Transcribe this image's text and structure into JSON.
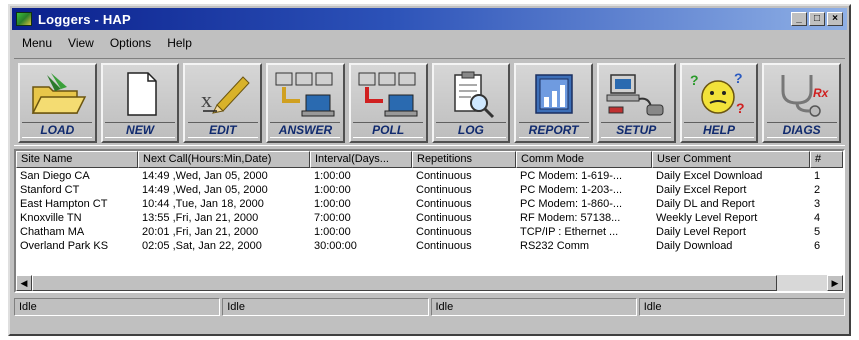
{
  "window": {
    "title": "Loggers - HAP"
  },
  "menu": [
    {
      "label": "Menu"
    },
    {
      "label": "View"
    },
    {
      "label": "Options"
    },
    {
      "label": "Help"
    }
  ],
  "toolbar": {
    "load_label": "LOAD",
    "new_label": "NEW",
    "edit_label": "EDIT",
    "answer_label": "ANSWER",
    "poll_label": "POLL",
    "log_label": "LOG",
    "report_label": "REPORT",
    "setup_label": "SETUP",
    "help_label": "HELP",
    "diags_label": "DIAGS",
    "icons": [
      "folder-open-icon",
      "new-document-icon",
      "pencil-icon",
      "answer-icon",
      "poll-icon",
      "clipboard-magnifier-icon",
      "report-icon",
      "setup-computer-icon",
      "smiley-help-icon",
      "stethoscope-icon"
    ]
  },
  "table": {
    "headers": [
      "Site Name",
      "Next Call(Hours:Min,Date)",
      "Interval(Days...",
      "Repetitions",
      "Comm Mode",
      "User Comment",
      "#"
    ],
    "rows": [
      [
        "San Diego CA",
        "14:49 ,Wed, Jan 05, 2000",
        "1:00:00",
        "Continuous",
        "PC Modem: 1-619-...",
        "Daily Excel Download",
        "1"
      ],
      [
        "Stanford CT",
        "14:49 ,Wed, Jan 05, 2000",
        "1:00:00",
        "Continuous",
        "PC Modem: 1-203-...",
        "Daily Excel Report",
        "2"
      ],
      [
        "East Hampton CT",
        "10:44 ,Tue, Jan 18, 2000",
        "1:00:00",
        "Continuous",
        "PC Modem: 1-860-...",
        "Daily DL and Report",
        "3"
      ],
      [
        "Knoxville TN",
        "13:55 ,Fri, Jan 21, 2000",
        "7:00:00",
        "Continuous",
        "RF Modem: 57138...",
        "Weekly Level Report",
        "4"
      ],
      [
        "Chatham MA",
        "20:01 ,Fri, Jan 21, 2000",
        "1:00:00",
        "Continuous",
        "TCP/IP : Ethernet ...",
        "Daily Level Report",
        "5"
      ],
      [
        "Overland Park KS",
        "02:05 ,Sat, Jan 22, 2000",
        "30:00:00",
        "Continuous",
        "RS232 Comm",
        "Daily Download",
        "6"
      ]
    ]
  },
  "status": [
    "Idle",
    "Idle",
    "Idle",
    "Idle"
  ],
  "colors": {
    "title_start": "#0a1f8c",
    "title_end": "#8fb0e6",
    "face": "#c0c0c0",
    "tool_label": "#102a6e"
  }
}
